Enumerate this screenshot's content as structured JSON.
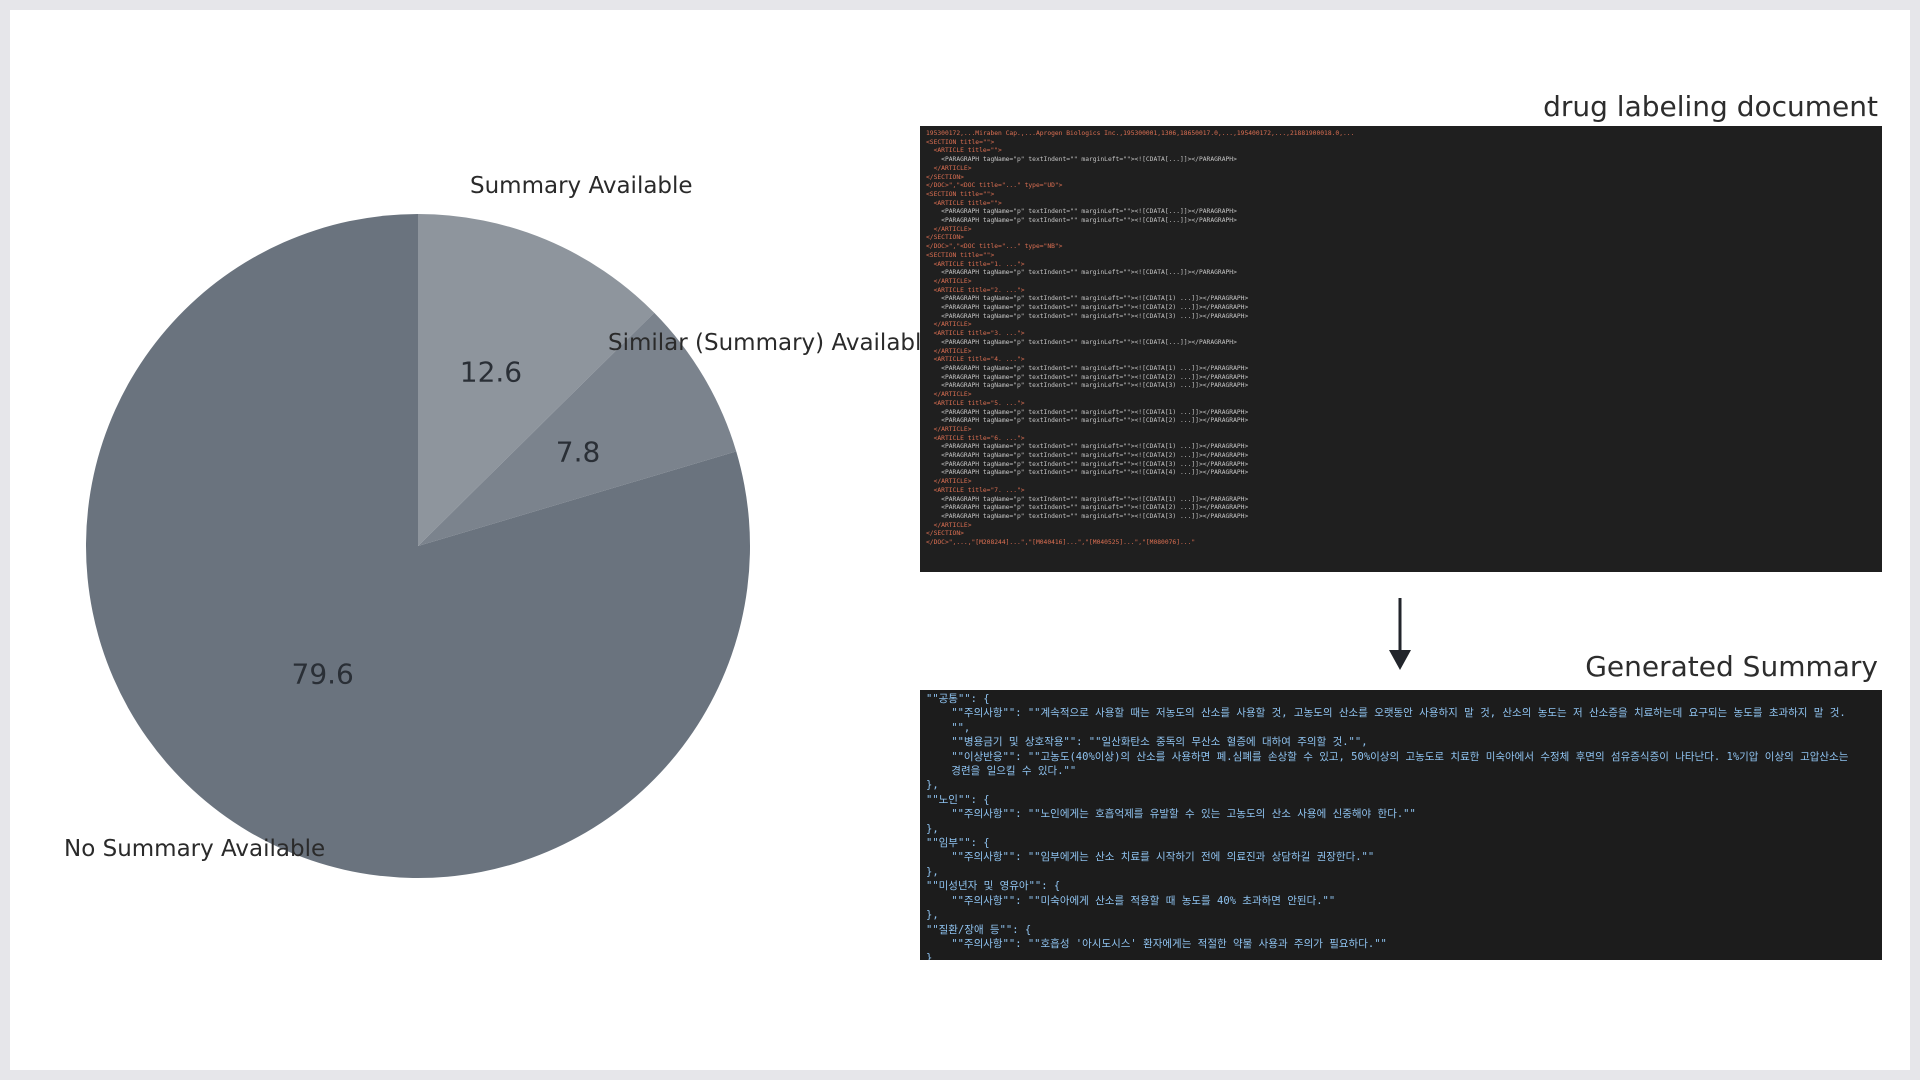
{
  "chart_data": {
    "type": "pie",
    "slices": [
      {
        "label": "Summary Available",
        "value": 12.6,
        "value_label": "12.6",
        "color": "#8e959d"
      },
      {
        "label": "Similar (Summary) Available",
        "value": 7.8,
        "value_label": "7.8",
        "color": "#7b838d"
      },
      {
        "label": "No Summary Available",
        "value": 79.6,
        "value_label": "79.6",
        "color": "#6a737e"
      }
    ],
    "start": "top, clockwise"
  },
  "document_panel": {
    "title": "drug labeling document",
    "lines": [
      "195300172,...Miraben Cap.,...Aprogen Biologics Inc.,195300001,1306,18650017.0,...,195400172,...,21881900018.0,...",
      "<SECTION title=\"\">",
      "  <ARTICLE title=\"\">",
      "    <PARAGRAPH tagName=\"p\" textIndent=\"\" marginLeft=\"\"><![CDATA[...]]></PARAGRAPH>",
      "  </ARTICLE>",
      "</SECTION>",
      "</DOC>\",\"<DOC title=\"...\" type=\"UD\">",
      "<SECTION title=\"\">",
      "  <ARTICLE title=\"\">",
      "    <PARAGRAPH tagName=\"p\" textIndent=\"\" marginLeft=\"\"><![CDATA[...]]></PARAGRAPH>",
      "    <PARAGRAPH tagName=\"p\" textIndent=\"\" marginLeft=\"\"><![CDATA[...]]></PARAGRAPH>",
      "  </ARTICLE>",
      "</SECTION>",
      "</DOC>\",\"<DOC title=\"...\" type=\"NB\">",
      "<SECTION title=\"\">",
      "  <ARTICLE title=\"1. ...\">",
      "    <PARAGRAPH tagName=\"p\" textIndent=\"\" marginLeft=\"\"><![CDATA[...]]></PARAGRAPH>",
      "  </ARTICLE>",
      "  <ARTICLE title=\"2. ...\">",
      "    <PARAGRAPH tagName=\"p\" textIndent=\"\" marginLeft=\"\"><![CDATA[1) ...]]></PARAGRAPH>",
      "    <PARAGRAPH tagName=\"p\" textIndent=\"\" marginLeft=\"\"><![CDATA[2) ...]]></PARAGRAPH>",
      "    <PARAGRAPH tagName=\"p\" textIndent=\"\" marginLeft=\"\"><![CDATA[3) ...]]></PARAGRAPH>",
      "  </ARTICLE>",
      "  <ARTICLE title=\"3. ...\">",
      "    <PARAGRAPH tagName=\"p\" textIndent=\"\" marginLeft=\"\"><![CDATA[...]]></PARAGRAPH>",
      "  </ARTICLE>",
      "  <ARTICLE title=\"4. ...\">",
      "    <PARAGRAPH tagName=\"p\" textIndent=\"\" marginLeft=\"\"><![CDATA[1) ...]]></PARAGRAPH>",
      "    <PARAGRAPH tagName=\"p\" textIndent=\"\" marginLeft=\"\"><![CDATA[2) ...]]></PARAGRAPH>",
      "    <PARAGRAPH tagName=\"p\" textIndent=\"\" marginLeft=\"\"><![CDATA[3) ...]]></PARAGRAPH>",
      "  </ARTICLE>",
      "  <ARTICLE title=\"5. ...\">",
      "    <PARAGRAPH tagName=\"p\" textIndent=\"\" marginLeft=\"\"><![CDATA[1) ...]]></PARAGRAPH>",
      "    <PARAGRAPH tagName=\"p\" textIndent=\"\" marginLeft=\"\"><![CDATA[2) ...]]></PARAGRAPH>",
      "  </ARTICLE>",
      "  <ARTICLE title=\"6. ...\">",
      "    <PARAGRAPH tagName=\"p\" textIndent=\"\" marginLeft=\"\"><![CDATA[1) ...]]></PARAGRAPH>",
      "    <PARAGRAPH tagName=\"p\" textIndent=\"\" marginLeft=\"\"><![CDATA[2) ...]]></PARAGRAPH>",
      "    <PARAGRAPH tagName=\"p\" textIndent=\"\" marginLeft=\"\"><![CDATA[3) ...]]></PARAGRAPH>",
      "    <PARAGRAPH tagName=\"p\" textIndent=\"\" marginLeft=\"\"><![CDATA[4) ...]]></PARAGRAPH>",
      "  </ARTICLE>",
      "  <ARTICLE title=\"7. ...\">",
      "    <PARAGRAPH tagName=\"p\" textIndent=\"\" marginLeft=\"\"><![CDATA[1) ...]]></PARAGRAPH>",
      "    <PARAGRAPH tagName=\"p\" textIndent=\"\" marginLeft=\"\"><![CDATA[2) ...]]></PARAGRAPH>",
      "    <PARAGRAPH tagName=\"p\" textIndent=\"\" marginLeft=\"\"><![CDATA[3) ...]]></PARAGRAPH>",
      "  </ARTICLE>",
      "</SECTION>",
      "</DOC>\",...,\"[M208244]...\",\"[M040416]...\",\"[M040525]...\",\"[M080076]...\""
    ]
  },
  "summary_panel": {
    "title": "Generated Summary",
    "lines": [
      "\"\"공통\"\": {",
      "    \"\"주의사항\"\": \"\"계속적으로 사용할 때는 저농도의 산소를 사용할 것, 고농도의 산소를 오랫동안 사용하지 말 것, 산소의 농도는 저 산소증을 치료하는데 요구되는 농도를 초과하지 말 것.",
      "    \"\",",
      "    \"\"병용금기 및 상호작용\"\": \"\"일산화탄소 중독의 무산소 혈증에 대하여 주의할 것.\"\",",
      "    \"\"이상반응\"\": \"\"고농도(40%이상)의 산소를 사용하면 폐.심폐를 손상할 수 있고, 50%이상의 고농도로 치료한 미숙아에서 수정체 후면의 섬유증식증이 나타난다. 1%기압 이상의 고압산소는",
      "    경련을 일으킬 수 있다.\"\"",
      "},",
      "\"\"노인\"\": {",
      "    \"\"주의사항\"\": \"\"노인에게는 호흡억제를 유발할 수 있는 고농도의 산소 사용에 신중해야 한다.\"\"",
      "},",
      "\"\"임부\"\": {",
      "    \"\"주의사항\"\": \"\"임부에게는 산소 치료를 시작하기 전에 의료진과 상담하길 권장한다.\"\"",
      "},",
      "\"\"미성년자 및 영유아\"\": {",
      "    \"\"주의사항\"\": \"\"미숙아에게 산소를 적용할 때 농도를 40% 초과하면 안된다.\"\"",
      "},",
      "\"\"질환/장애 등\"\": {",
      "    \"\"주의사항\"\": \"\"호흡성 '아시도시스' 환자에게는 적절한 약물 사용과 주의가 필요하다.\"\"",
      "}"
    ]
  },
  "arrow_icon": "down-arrow-icon"
}
